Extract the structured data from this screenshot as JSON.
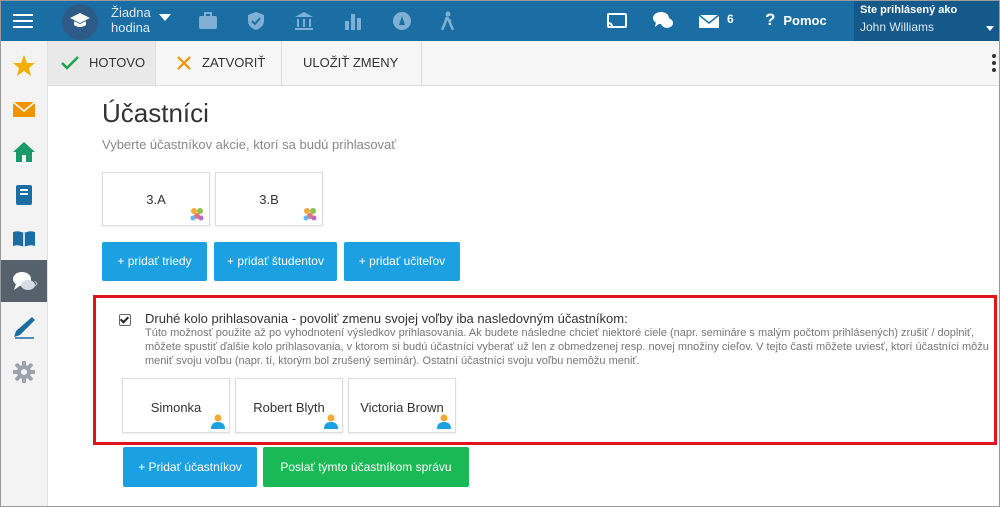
{
  "topbar": {
    "hour_line1": "Žiadna",
    "hour_line2": "hodina",
    "message_count": "6",
    "help_label": "Pomoc",
    "user_label": "Ste prihlásený ako",
    "user_name": "John Williams"
  },
  "toolbar": {
    "done_label": "HOTOVO",
    "close_label": "ZATVORIŤ",
    "save_label": "ULOŽIŤ ZMENY"
  },
  "page": {
    "title": "Účastníci",
    "subtitle": "Vyberte účastníkov akcie, ktorí sa budú prihlasovať"
  },
  "classes": [
    "3.A",
    "3.B"
  ],
  "add_buttons": {
    "classes": "+ pridať triedy",
    "students": "+ pridať študentov",
    "teachers": "+ pridať učiteľov"
  },
  "second_round": {
    "checked": true,
    "title": "Druhé kolo prihlasovania - povoliť zmenu svojej voľby iba nasledovným účastníkom:",
    "description": "Túto možnosť použite až po vyhodnotení výsledkov prihlasovania. Ak budete následne chcieť niektoré ciele (napr. semináre s malým počtom prihlásených) zrušiť / doplniť, môžete spustiť ďalšie kolo prihlasovania, v ktorom si budú účastníci vyberať už len z obmedzenej resp. novej množiny cieľov. V tejto časti môžete uviesť, ktorí účastníci môžu meniť svoju voľbu (napr. tí, ktorým bol zrušený seminár). Ostatní účastníci svoju voľbu nemôžu meniť.",
    "participants": [
      "Simonka",
      "Robert Blyth",
      "Victoria Brown"
    ],
    "add_button": "+ Pridať účastníkov",
    "message_button": "Poslať týmto účastníkom správu"
  },
  "colors": {
    "topbar": "#1b6ea3",
    "accent_blue": "#1ba1e2",
    "accent_green": "#19b955",
    "highlight_red": "#e0141e"
  }
}
